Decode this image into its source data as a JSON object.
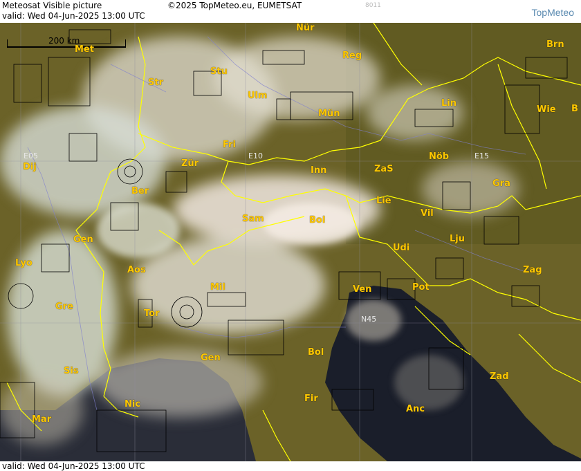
{
  "header": {
    "title": "Meteosat Visible picture",
    "copyright": "©2025 TopMeteo.eu, EUMETSAT",
    "valid": "valid:  Wed  04-Jun-2025  13:00 UTC",
    "code": "8011",
    "logo": "TopMeteo"
  },
  "footer": {
    "valid": "valid:  Wed  04-Jun-2025  13:00 UTC"
  },
  "scale": {
    "label": "200 km"
  },
  "grid_labels": [
    "E05",
    "E10",
    "E15",
    "N45"
  ],
  "cities": [
    "Met",
    "Str",
    "Stu",
    "Nür",
    "Reg",
    "Brn",
    "Ulm",
    "Mün",
    "Lin",
    "Wie",
    "B",
    "Fri",
    "Dij",
    "Zür",
    "Inn",
    "ZaS",
    "Nöb",
    "Gra",
    "Ber",
    "Lie",
    "Vil",
    "Sam",
    "Bol",
    "Lju",
    "Gen",
    "Udi",
    "Lyo",
    "Aos",
    "Mil",
    "Ven",
    "Pot",
    "Zag",
    "Gre",
    "Tor",
    "Gen",
    "Bol",
    "Sis",
    "Zad",
    "Nic",
    "Fir",
    "Mar",
    "Anc"
  ],
  "colors": {
    "city": "#ffc800",
    "border": "#ffff00",
    "sea": "#1a1e2a",
    "land": "#6b6228"
  }
}
